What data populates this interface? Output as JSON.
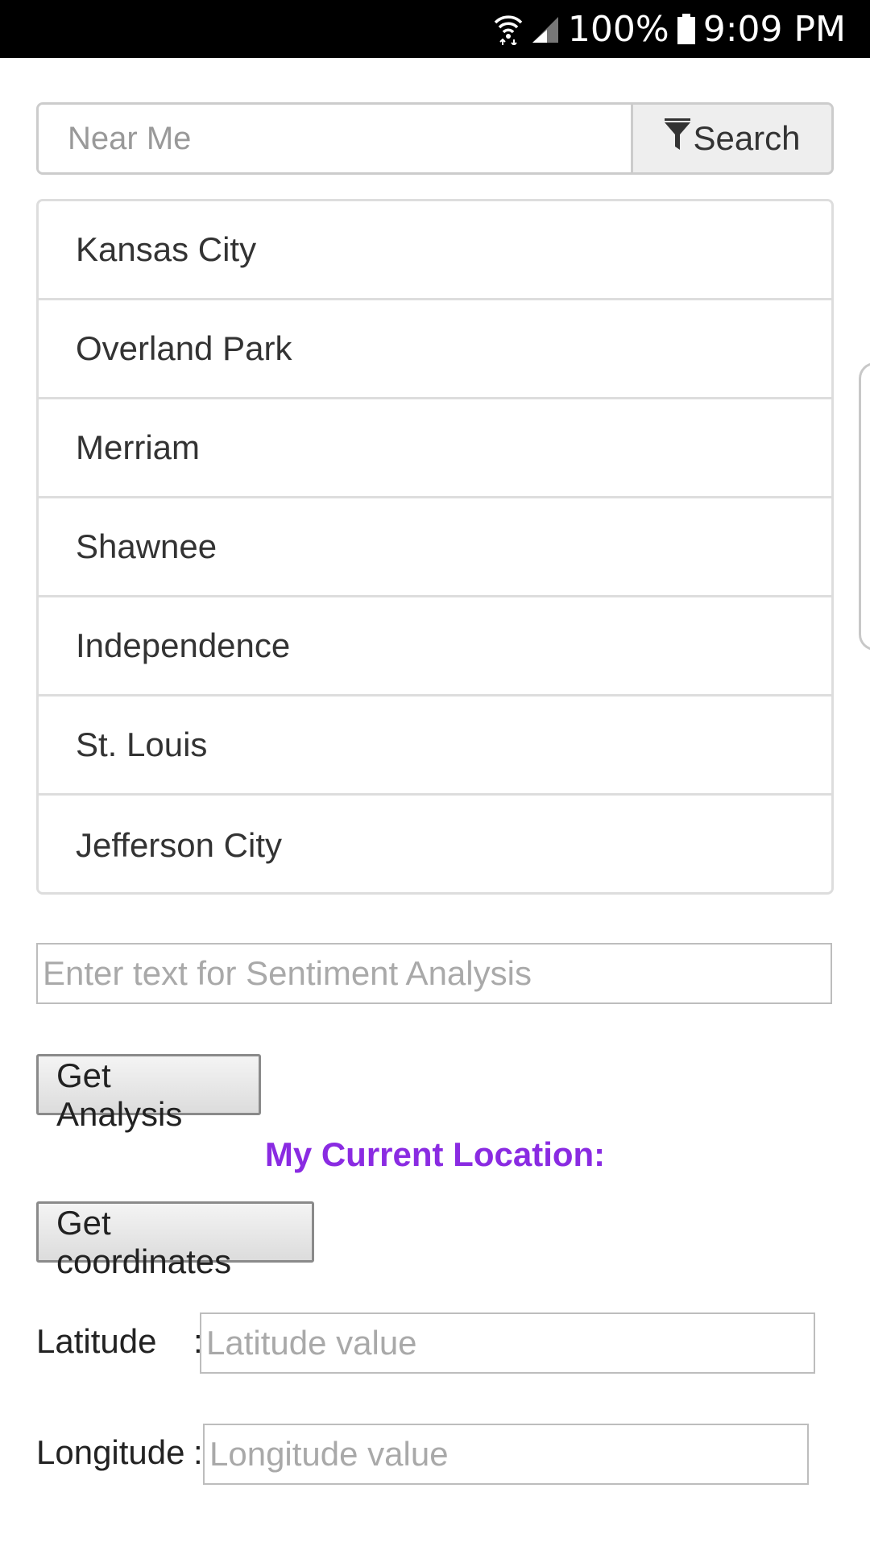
{
  "status_bar": {
    "battery": "100%",
    "time": "9:09 PM"
  },
  "search": {
    "placeholder": "Near Me",
    "button_label": "Search",
    "button_icon": "filter-icon"
  },
  "cities": [
    {
      "label": "Kansas City"
    },
    {
      "label": "Overland Park"
    },
    {
      "label": "Merriam"
    },
    {
      "label": "Shawnee"
    },
    {
      "label": "Independence"
    },
    {
      "label": "St. Louis"
    },
    {
      "label": "Jefferson City"
    }
  ],
  "sentiment": {
    "placeholder": "Enter text for Sentiment Analysis",
    "button_label": "Get Analysis"
  },
  "location": {
    "heading": "My Current Location:",
    "heading_color": "#8a2be2",
    "button_label": "Get coordinates",
    "latitude_label": "Latitude",
    "latitude_placeholder": "Latitude value",
    "longitude_label": "Longitude",
    "longitude_placeholder": "Longitude value",
    "separator": ":"
  }
}
